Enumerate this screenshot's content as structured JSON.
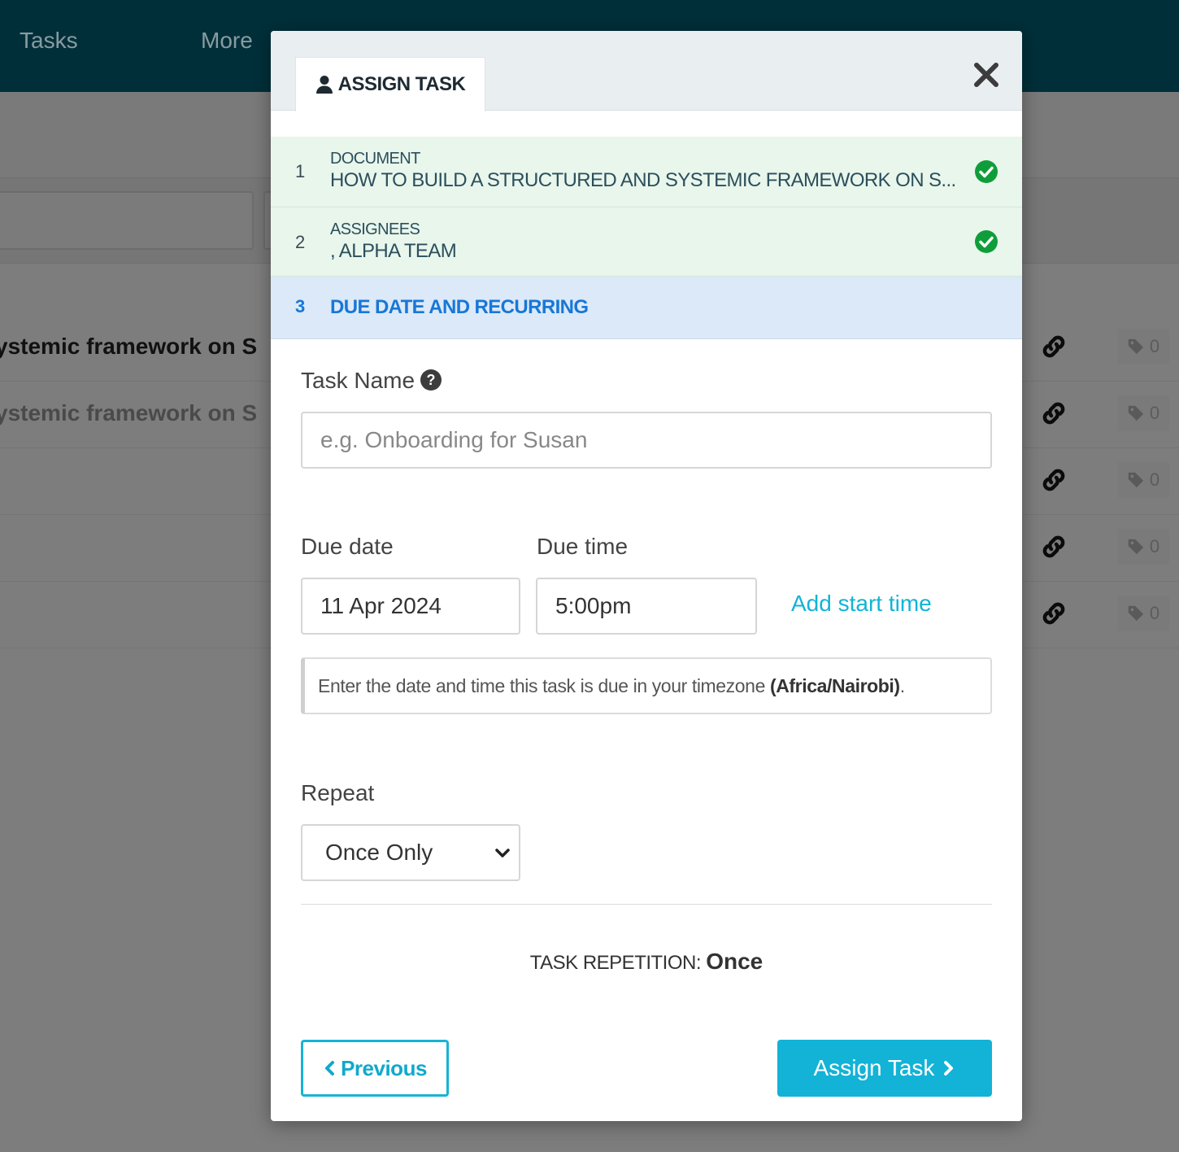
{
  "app": {
    "nav": [
      "Tasks",
      "More"
    ],
    "rows": [
      {
        "title": "ystemic framework on S",
        "tag_count": "0"
      },
      {
        "title": "ystemic framework on S",
        "tag_count": "0"
      },
      {
        "title": "",
        "tag_count": "0"
      },
      {
        "title": "",
        "tag_count": "0"
      },
      {
        "title": "",
        "tag_count": "0"
      }
    ]
  },
  "modal": {
    "tab_label": "ASSIGN TASK",
    "steps": [
      {
        "number": "1",
        "label": "DOCUMENT",
        "value": "HOW TO BUILD A STRUCTURED AND SYSTEMIC FRAMEWORK ON S...",
        "status": "complete"
      },
      {
        "number": "2",
        "label": "ASSIGNEES",
        "value": ", ALPHA TEAM",
        "status": "complete"
      },
      {
        "number": "3",
        "title": "DUE DATE AND RECURRING",
        "status": "active"
      }
    ],
    "task_name": {
      "label": "Task Name",
      "placeholder": "e.g. Onboarding for Susan",
      "value": ""
    },
    "due_date": {
      "label": "Due date",
      "value": "11 Apr 2024"
    },
    "due_time": {
      "label": "Due time",
      "value": "5:00pm"
    },
    "add_start_time": "Add start time",
    "timezone_hint": {
      "text": "Enter the date and time this task is due in your timezone ",
      "timezone": "(Africa/Nairobi)",
      "suffix": "."
    },
    "repeat": {
      "label": "Repeat",
      "selected": "Once Only"
    },
    "repetition_summary": {
      "label": "TASK REPETITION:",
      "value": "Once"
    },
    "buttons": {
      "previous": "Previous",
      "assign": "Assign Task"
    }
  },
  "colors": {
    "accent": "#12b3d6",
    "active_step": "#1877d6",
    "success": "#0f9d3a",
    "topbar": "#002f3a"
  }
}
